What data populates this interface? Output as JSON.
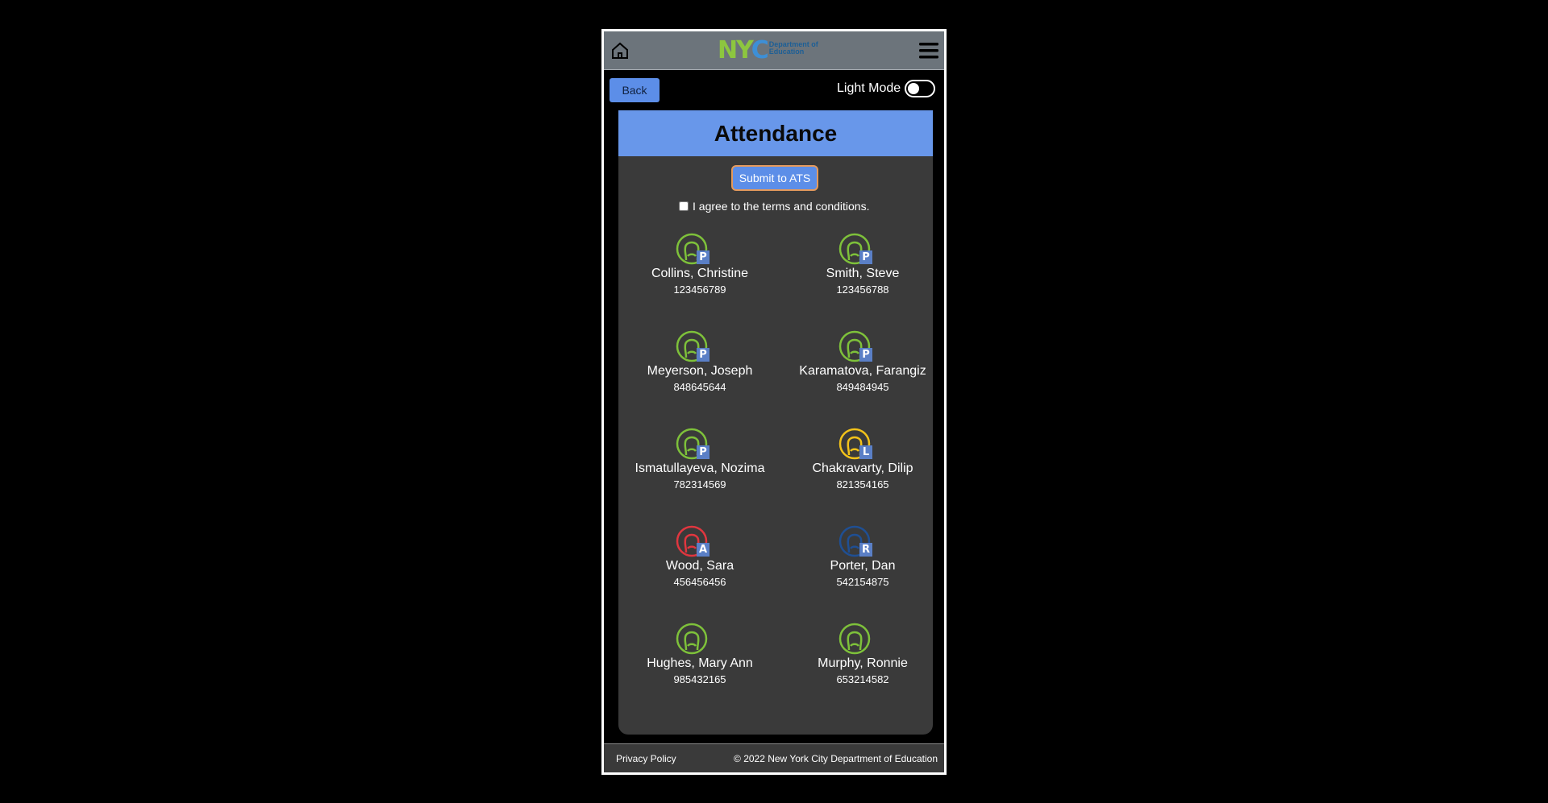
{
  "header": {
    "home_icon": "home-icon",
    "menu_icon": "hamburger-menu-icon",
    "logo_letters": "NYC",
    "logo_line1": "Department of",
    "logo_line2": "Education"
  },
  "toolbar": {
    "back_label": "Back",
    "mode_label": "Light Mode"
  },
  "main": {
    "title": "Attendance",
    "submit_label": "Submit to ATS",
    "terms_label": "I agree to the terms and conditions."
  },
  "students": [
    {
      "name": "Collins, Christine",
      "id": "123456789",
      "status": "P",
      "color": "#7ec13a"
    },
    {
      "name": "Smith, Steve",
      "id": "123456788",
      "status": "P",
      "color": "#7ec13a"
    },
    {
      "name": "Meyerson, Joseph",
      "id": "848645644",
      "status": "P",
      "color": "#7ec13a"
    },
    {
      "name": "Karamatova, Farangiz",
      "id": "849484945",
      "status": "P",
      "color": "#7ec13a"
    },
    {
      "name": "Ismatullayeva, Nozima",
      "id": "782314569",
      "status": "P",
      "color": "#7ec13a"
    },
    {
      "name": "Chakravarty, Dilip",
      "id": "821354165",
      "status": "L",
      "color": "#f2c21a"
    },
    {
      "name": "Wood, Sara",
      "id": "456456456",
      "status": "A",
      "color": "#e0363f"
    },
    {
      "name": "Porter, Dan",
      "id": "542154875",
      "status": "R",
      "color": "#1f4f93"
    },
    {
      "name": "Hughes, Mary Ann",
      "id": "985432165",
      "status": "",
      "color": "#7ec13a"
    },
    {
      "name": "Murphy, Ronnie",
      "id": "653214582",
      "status": "",
      "color": "#7ec13a"
    }
  ],
  "footer": {
    "privacy": "Privacy Policy",
    "copyright": "© 2022 New York City Department of Education"
  }
}
